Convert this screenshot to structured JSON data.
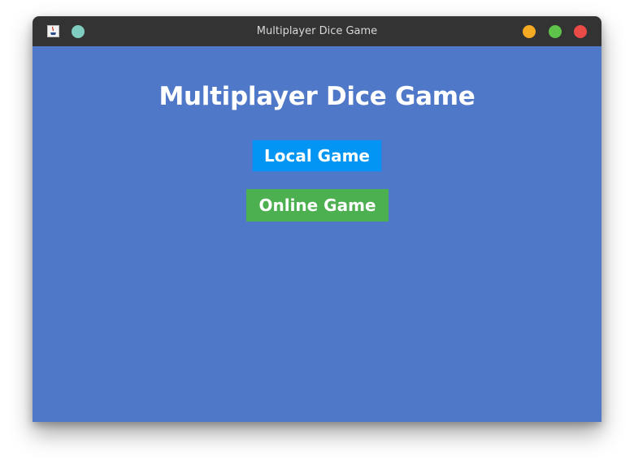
{
  "window": {
    "title": "Multiplayer Dice Game"
  },
  "main": {
    "heading": "Multiplayer Dice Game",
    "local_game_label": "Local Game",
    "online_game_label": "Online Game"
  },
  "colors": {
    "background": "#4f78c8",
    "titlebar": "#333333",
    "local_button": "#0295f4",
    "online_button": "#4caf50",
    "minimize": "#f5aa24",
    "maximize": "#5ec34a",
    "close": "#ea4b47",
    "sticky": "#7ecdc0"
  },
  "icons": {
    "app": "java-app-icon",
    "sticky": "sticky-pin-icon",
    "minimize": "minimize-icon",
    "maximize": "maximize-icon",
    "close": "close-icon"
  }
}
